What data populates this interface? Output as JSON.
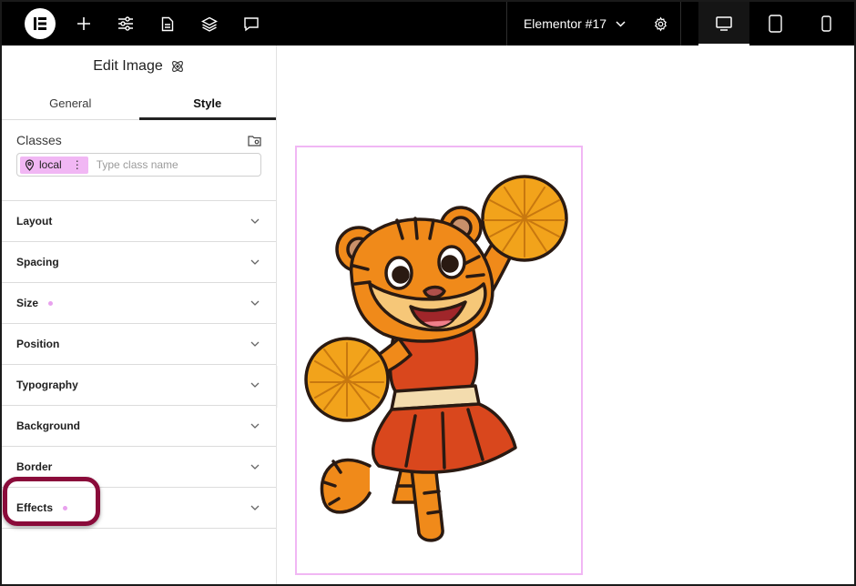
{
  "topbar": {
    "logo_icon": "elementor-logo-icon",
    "tools": [
      "add-icon",
      "sliders-icon",
      "page-icon",
      "layers-icon",
      "comment-icon"
    ],
    "document_title": "Elementor #17",
    "settings_icon": "gear-icon",
    "devices": [
      {
        "name": "desktop-icon",
        "active": true
      },
      {
        "name": "tablet-icon",
        "active": false
      },
      {
        "name": "mobile-icon",
        "active": false
      }
    ]
  },
  "panel": {
    "title": "Edit Image",
    "tabs": [
      {
        "label": "General",
        "active": false
      },
      {
        "label": "Style",
        "active": true
      }
    ],
    "classes": {
      "label": "Classes",
      "chip_label": "local",
      "chip_menu": "⋮",
      "placeholder": "Type class name"
    },
    "sections": [
      {
        "label": "Layout",
        "modified": false
      },
      {
        "label": "Spacing",
        "modified": false
      },
      {
        "label": "Size",
        "modified": true
      },
      {
        "label": "Position",
        "modified": false
      },
      {
        "label": "Typography",
        "modified": false
      },
      {
        "label": "Background",
        "modified": false
      },
      {
        "label": "Border",
        "modified": false
      },
      {
        "label": "Effects",
        "modified": true
      }
    ]
  },
  "canvas": {
    "image": "tiger-cheerleader-illustration"
  },
  "colors": {
    "topbar": "#000000",
    "accent_pink": "#f1b7f4",
    "highlight": "#8a0b3a"
  }
}
